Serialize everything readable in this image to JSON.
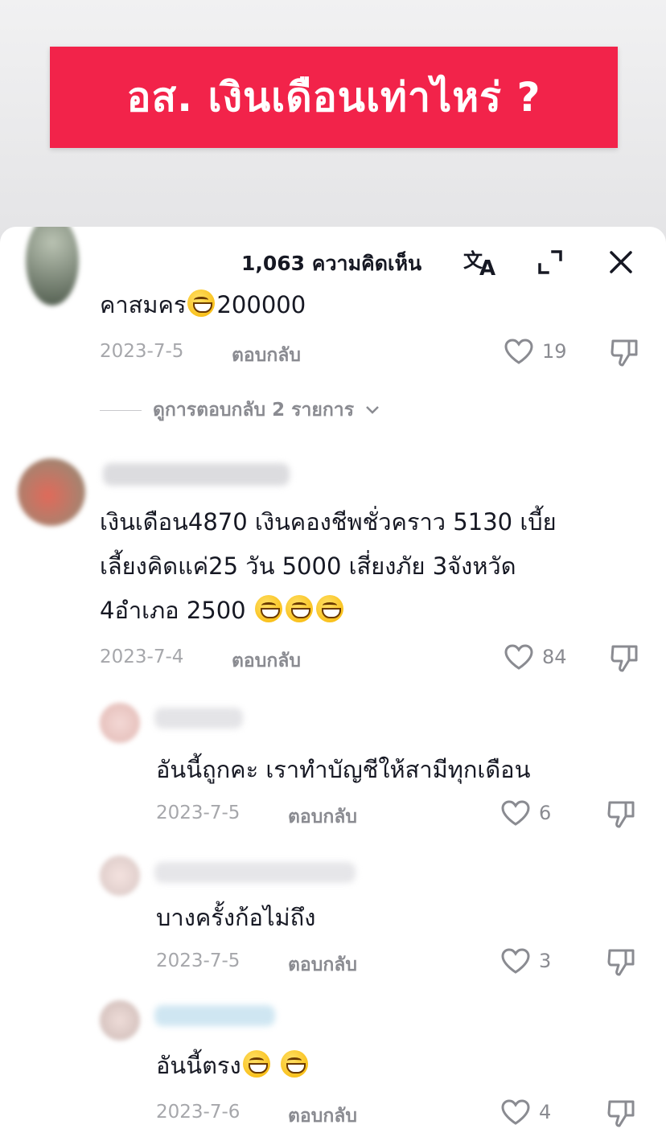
{
  "video": {
    "title": "อส. เงินเดือนเท่าไหร่ ?"
  },
  "header": {
    "comment_count": "1,063 ความคิดเห็น"
  },
  "comments": [
    {
      "text": "คาสมคร",
      "text_after": "200000",
      "date": "2023-7-5",
      "reply": "ตอบกลับ",
      "likes": "19"
    },
    {
      "line1": "เงินเดือน4870 เงินคองชีพชั่วคราว 5130 เบี้ย",
      "line2": "เลี้ยงคิดแค่25 วัน 5000 เสี่ยงภัย 3จังหวัด",
      "line3": "4อำเภอ 2500",
      "date": "2023-7-4",
      "reply": "ตอบกลับ",
      "likes": "84"
    },
    {
      "text": "อันนี้ถูกคะ เราทำบัญชีให้สามีทุกเดือน",
      "date": "2023-7-5",
      "reply": "ตอบกลับ",
      "likes": "6"
    },
    {
      "text": "บางครั้งก้อไม่ถึง",
      "date": "2023-7-5",
      "reply": "ตอบกลับ",
      "likes": "3"
    },
    {
      "text": "อันนี้ตรง",
      "date": "2023-7-6",
      "reply": "ตอบกลับ",
      "likes": "4"
    }
  ],
  "view_replies": {
    "label": "ดูการตอบกลับ 2 รายการ"
  },
  "icons": {
    "translate": "translate-icon",
    "expand": "expand-icon",
    "close": "close-icon",
    "like": "heart-outline-icon",
    "dislike": "thumbs-down-icon",
    "chevron": "chevron-down-icon",
    "emoji": "grinning-sweat-emoji"
  },
  "colors": {
    "banner": "#f2234a",
    "text": "#161823",
    "muted": "#8a8b91"
  }
}
